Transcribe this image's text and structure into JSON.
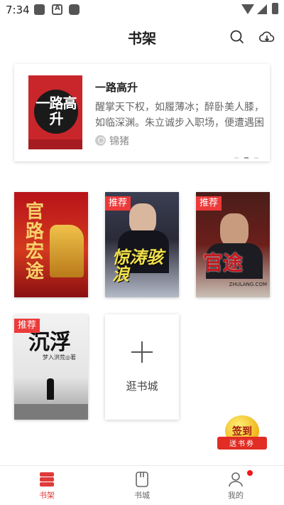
{
  "status_bar": {
    "time": "7:34",
    "icons": [
      "square-icon",
      "a-icon",
      "rounded-square-icon",
      "wifi-icon",
      "signal-icon",
      "battery-icon"
    ]
  },
  "header": {
    "title": "书架",
    "search_icon": "search-icon",
    "cloud_icon": "cloud-download-icon"
  },
  "featured": {
    "cover_text": "一路高升",
    "title": "一路高升",
    "description": "醒掌天下权，如履薄冰；醉卧美人膝，如临深渊。朱立诚步入职场，便遭遇困境...",
    "author": "锦猪",
    "author_icon": "author-icon",
    "page_indicator": {
      "count": 3,
      "active_index": 1
    }
  },
  "books": [
    {
      "cover_text": "官路宏途",
      "badge": ""
    },
    {
      "cover_text": "惊涛骇浪",
      "badge": "推荐"
    },
    {
      "cover_text": "官途",
      "badge": "推荐",
      "cover_subtext": "ZHULANG.COM"
    },
    {
      "cover_text": "沉浮",
      "badge": "推荐",
      "cover_subtext": "梦入洪荒◎著"
    }
  ],
  "add_book": {
    "label": "逛书城",
    "icon": "plus-icon"
  },
  "checkin": {
    "title": "签到",
    "subtitle": "送书券"
  },
  "bottom_nav": {
    "items": [
      {
        "label": "书架",
        "icon": "bookshelf-icon",
        "active": true
      },
      {
        "label": "书城",
        "icon": "bookstore-icon",
        "active": false
      },
      {
        "label": "我的",
        "icon": "profile-icon",
        "active": false,
        "has_notification": true
      }
    ],
    "active_color": "#e03a3a"
  },
  "colors": {
    "accent": "#e03a3a",
    "badge": "#ec3a3a"
  }
}
